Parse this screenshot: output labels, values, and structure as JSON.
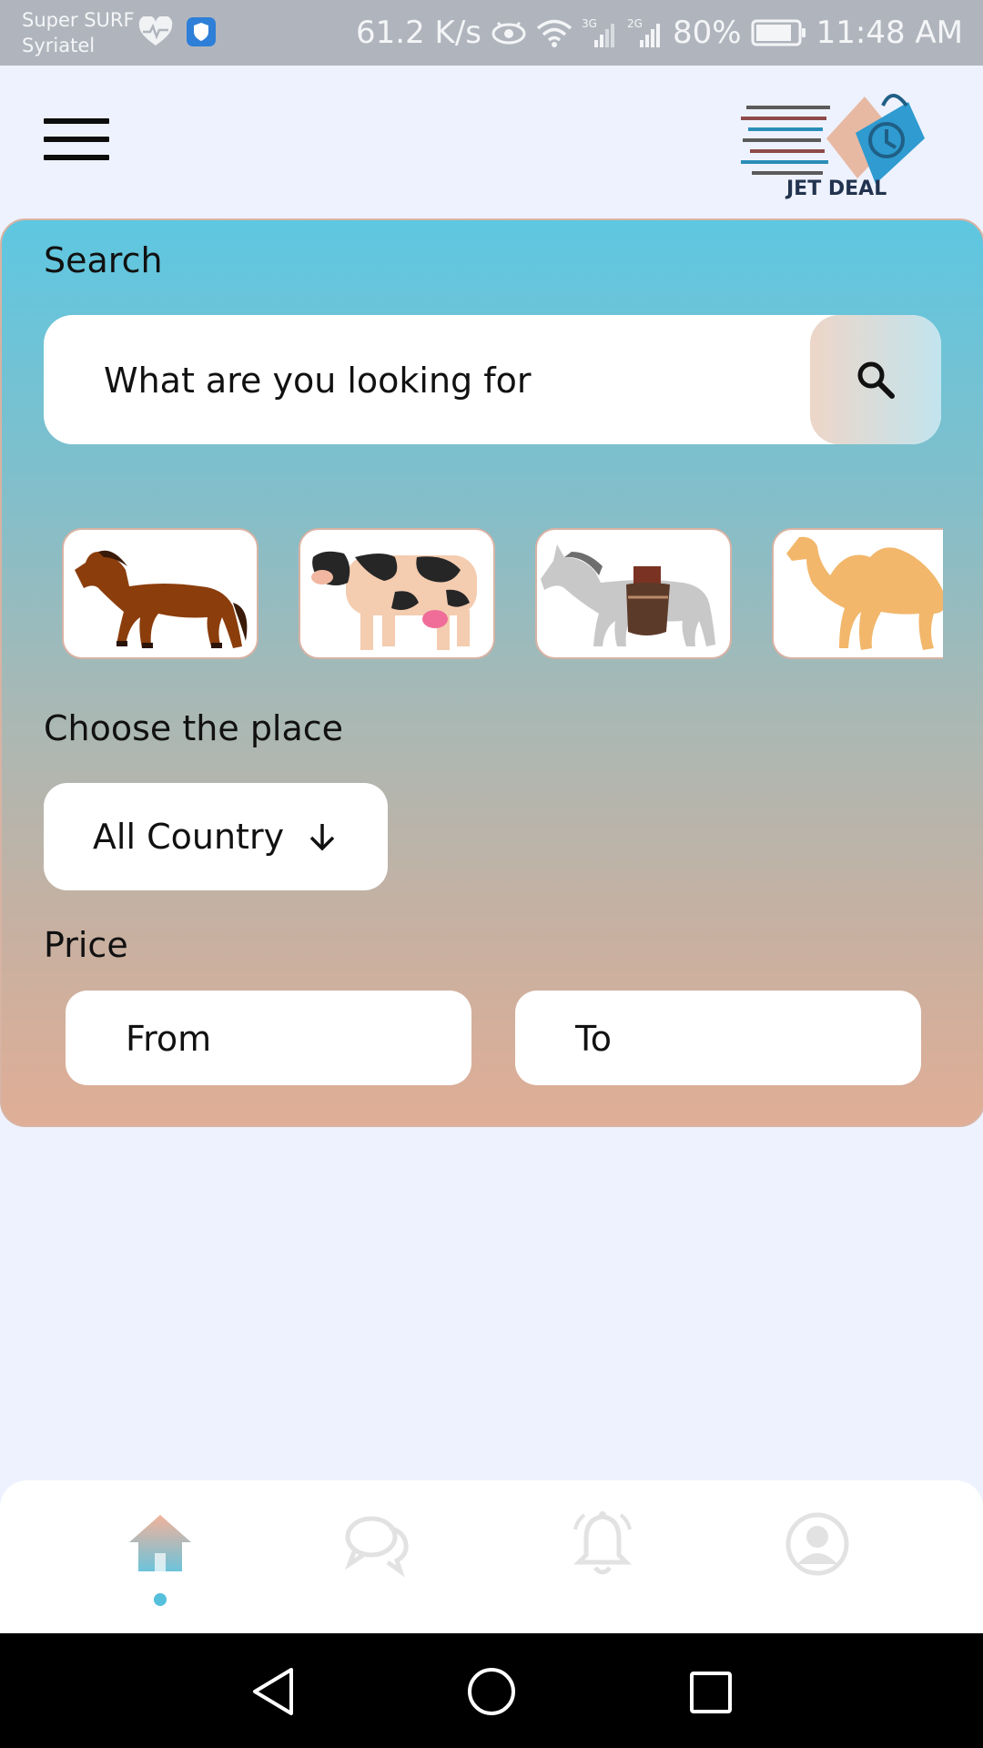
{
  "status_bar": {
    "carrier_line1": "Super SURF",
    "carrier_line2": "Syriatel",
    "net_speed": "61.2 K/s",
    "net_3g": "3G",
    "net_2g": "2G",
    "battery": "80%",
    "time": "11:48 AM"
  },
  "header": {
    "menu_icon": "hamburger-menu-icon",
    "logo_text": "JET DEAL"
  },
  "search": {
    "label": "Search",
    "placeholder": "What are you looking for",
    "button_icon": "search-icon"
  },
  "categories": [
    {
      "name": "horse"
    },
    {
      "name": "cow"
    },
    {
      "name": "donkey"
    },
    {
      "name": "camel"
    }
  ],
  "place": {
    "label": "Choose the place",
    "selected": "All Country",
    "icon": "arrow-down-icon"
  },
  "price": {
    "label": "Price",
    "from_placeholder": "From",
    "to_placeholder": "To"
  },
  "bottom_nav": {
    "items": [
      {
        "icon": "home-icon",
        "active": true
      },
      {
        "icon": "chat-icon",
        "active": false
      },
      {
        "icon": "bell-icon",
        "active": false
      },
      {
        "icon": "profile-icon",
        "active": false
      }
    ]
  },
  "colors": {
    "card_top": "#5ec7e1",
    "card_bottom": "#e0ae96",
    "active_dot": "#55c0dc",
    "inactive_icon": "#e2e2e2"
  }
}
